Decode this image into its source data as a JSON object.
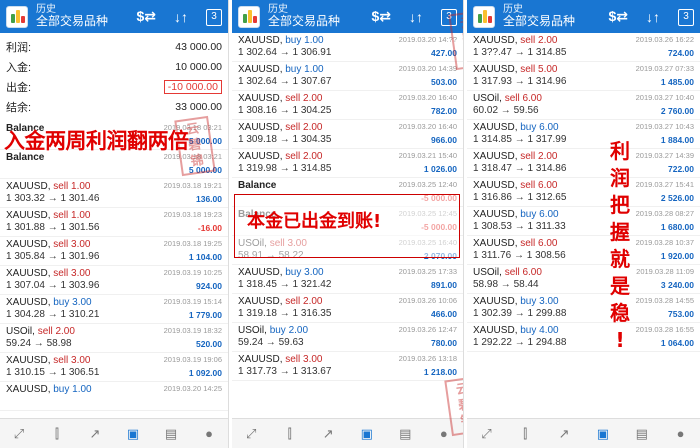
{
  "app": {
    "title_top": "历史",
    "title_main": "全部交易品种",
    "calendar_day": "3"
  },
  "summary": [
    {
      "label": "利润:",
      "value": "43 000.00"
    },
    {
      "label": "入金:",
      "value": "10 000.00"
    },
    {
      "label": "出金:",
      "value": "-10 000.00"
    },
    {
      "label": "结余:",
      "value": "33 000.00"
    }
  ],
  "overlays": {
    "left": "入金两周利润翻两倍",
    "middle": "本金已出金到账!",
    "right": [
      "利",
      "润",
      "把",
      "握",
      "就",
      "是",
      "稳",
      "!"
    ]
  },
  "stamp_text": [
    "云",
    "碧",
    "锦"
  ],
  "panel1": [
    {
      "sym": "Balance",
      "dir": "",
      "dt": "2019.03.18 03:21",
      "pl": "5 000.00",
      "type": "bal"
    },
    {
      "sym": "Balance",
      "dir": "",
      "dt": "2019.03.18 03:21",
      "pl": "5 000.00",
      "type": "bal"
    },
    {
      "sym": "XAUUSD",
      "dir": "sell 1.00",
      "prices": "1 303.32 → 1 301.46",
      "dt": "2019.03.18 19:21",
      "pl": "136.00"
    },
    {
      "sym": "XAUUSD",
      "dir": "sell 1.00",
      "prices": "1 301.88 → 1 301.56",
      "dt": "2019.03.18 19:23",
      "pl": "-16.00"
    },
    {
      "sym": "XAUUSD",
      "dir": "sell 3.00",
      "prices": "1 305.84 → 1 301.96",
      "dt": "2019.03.18 19:25",
      "pl": "1 104.00"
    },
    {
      "sym": "XAUUSD",
      "dir": "sell 3.00",
      "prices": "1 307.04 → 1 303.96",
      "dt": "2019.03.19 10:25",
      "pl": "924.00"
    },
    {
      "sym": "XAUUSD",
      "dir": "buy 3.00",
      "prices": "1 304.28 → 1 310.21",
      "dt": "2019.03.19 15:14",
      "pl": "1 779.00"
    },
    {
      "sym": "USOil",
      "dir": "sell 2.00",
      "prices": "59.24 → 58.98",
      "dt": "2019.03.19 18:32",
      "pl": "520.00"
    },
    {
      "sym": "XAUUSD",
      "dir": "sell 3.00",
      "prices": "1 310.15 → 1 306.51",
      "dt": "2019.03.19 19:06",
      "pl": "1 092.00"
    },
    {
      "sym": "XAUUSD",
      "dir": "buy 1.00",
      "prices": "",
      "dt": "2019.03.20 14:25",
      "pl": ""
    }
  ],
  "panel2": [
    {
      "sym": "XAUUSD",
      "dir": "buy 1.00",
      "prices": "1 302.64 → 1 306.91",
      "dt": "2019.03.20 14:??",
      "pl": "427.00"
    },
    {
      "sym": "XAUUSD",
      "dir": "buy 1.00",
      "prices": "1 302.64 → 1 307.67",
      "dt": "2019.03.20 14:39",
      "pl": "503.00"
    },
    {
      "sym": "XAUUSD",
      "dir": "sell 2.00",
      "prices": "1 308.16 → 1 304.25",
      "dt": "2019.03.20 16:40",
      "pl": "782.00"
    },
    {
      "sym": "XAUUSD",
      "dir": "sell 2.00",
      "prices": "1 309.18 → 1 304.35",
      "dt": "2019.03.20 16:40",
      "pl": "966.00"
    },
    {
      "sym": "XAUUSD",
      "dir": "sell 2.00",
      "prices": "1 319.98 → 1 314.85",
      "dt": "2019.03.21 15:40",
      "pl": "1 026.00"
    },
    {
      "sym": "Balance",
      "dir": "",
      "prices": "",
      "dt": "2019.03.25 12:40",
      "pl": "-5 000.00",
      "type": "bal"
    },
    {
      "sym": "Balance",
      "dir": "",
      "prices": "",
      "dt": "2019.03.25 12:45",
      "pl": "-5 000.00",
      "type": "bal"
    },
    {
      "sym": "USOil",
      "dir": "sell 3.00",
      "prices": "58.91 → 58.22",
      "dt": "2019.03.25 16:40",
      "pl": "2 070.00"
    },
    {
      "sym": "XAUUSD",
      "dir": "buy 3.00",
      "prices": "1 318.45 → 1 321.42",
      "dt": "2019.03.25 17:33",
      "pl": "891.00"
    },
    {
      "sym": "XAUUSD",
      "dir": "sell 2.00",
      "prices": "1 319.18 → 1 316.35",
      "dt": "2019.03.26 10:06",
      "pl": "466.00"
    },
    {
      "sym": "USOil",
      "dir": "buy 2.00",
      "prices": "59.24 → 59.63",
      "dt": "2019.03.26 12:47",
      "pl": "780.00"
    },
    {
      "sym": "XAUUSD",
      "dir": "sell 3.00",
      "prices": "1 317.73 → 1 313.67",
      "dt": "2019.03.26 13:18",
      "pl": "1 218.00"
    }
  ],
  "panel3": [
    {
      "sym": "XAUUSD",
      "dir": "sell 2.00",
      "prices": "1 3??.47 → 1 314.85",
      "dt": "2019.03.26 16:22",
      "pl": "724.00"
    },
    {
      "sym": "XAUUSD",
      "dir": "sell 5.00",
      "prices": "1 317.93 → 1 314.96",
      "dt": "2019.03.27 07:33",
      "pl": "1 485.00"
    },
    {
      "sym": "USOil",
      "dir": "sell 6.00",
      "prices": "60.02 → 59.56",
      "dt": "2019.03.27 10:40",
      "pl": "2 760.00"
    },
    {
      "sym": "XAUUSD",
      "dir": "buy 6.00",
      "prices": "1 314.85 → 1 317.99",
      "dt": "2019.03.27 10:43",
      "pl": "1 884.00"
    },
    {
      "sym": "XAUUSD",
      "dir": "sell 2.00",
      "prices": "1 318.47 → 1 314.86",
      "dt": "2019.03.27 14:39",
      "pl": "722.00"
    },
    {
      "sym": "XAUUSD",
      "dir": "sell 6.00",
      "prices": "1 316.86 → 1 312.65",
      "dt": "2019.03.27 15:41",
      "pl": "2 526.00"
    },
    {
      "sym": "XAUUSD",
      "dir": "buy 6.00",
      "prices": "1 308.53 → 1 311.33",
      "dt": "2019.03.28 08:27",
      "pl": "1 680.00"
    },
    {
      "sym": "XAUUSD",
      "dir": "sell 6.00",
      "prices": "1 311.76 → 1 308.56",
      "dt": "2019.03.28 10:37",
      "pl": "1 920.00"
    },
    {
      "sym": "USOil",
      "dir": "sell 6.00",
      "prices": "58.98 → 58.44",
      "dt": "2019.03.28 11:09",
      "pl": "3 240.00"
    },
    {
      "sym": "XAUUSD",
      "dir": "buy 3.00",
      "prices": "1 302.39 → 1 299.88",
      "dt": "2019.03.28 14:55",
      "pl": "753.00"
    },
    {
      "sym": "XAUUSD",
      "dir": "buy 4.00",
      "prices": "1 292.22 → 1 294.88",
      "dt": "2019.03.28 16:55",
      "pl": "1 064.00"
    }
  ],
  "icons": {
    "filter": "⇅",
    "sort": "↓↑",
    "tabs": [
      "trade-tab-icon",
      "chart-tab-icon",
      "history-trend-icon",
      "inbox-icon",
      "news-icon",
      "chat-icon"
    ]
  },
  "colors": {
    "appbar": "#1976d2",
    "buy": "#1565c0",
    "sell": "#c62828",
    "profit": "#1565c0",
    "loss": "#e53935",
    "overlay": "#e00000"
  }
}
